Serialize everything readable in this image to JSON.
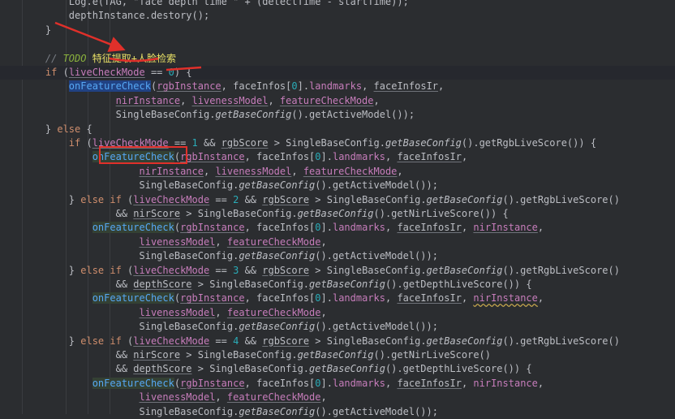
{
  "code_lines": [
    {
      "tokens": [
        {
          "t": "        Log.e(TAG, \"face depth time \" + (detectTime - startTime));",
          "c": "ident"
        }
      ]
    },
    {
      "tokens": [
        {
          "t": "        ",
          "c": "ident"
        },
        {
          "t": "depthInstance",
          "c": "ident"
        },
        {
          "t": ".destory();",
          "c": "ident"
        }
      ]
    },
    {
      "tokens": [
        {
          "t": "    }",
          "c": "ident"
        }
      ]
    },
    {
      "tokens": []
    },
    {
      "tokens": [
        {
          "t": "    // ",
          "c": "comment"
        },
        {
          "t": "TODO",
          "c": "todo"
        },
        {
          "t": " ",
          "c": "todo"
        },
        {
          "t": "特征提取+人脸检索",
          "c": "cn"
        }
      ]
    },
    {
      "tokens": [
        {
          "t": "    ",
          "c": "ident"
        },
        {
          "t": "if",
          "c": "kw"
        },
        {
          "t": " (",
          "c": "ident"
        },
        {
          "t": "liveCheckMode",
          "c": "field ul"
        },
        {
          "t": " == ",
          "c": "ident"
        },
        {
          "t": "0",
          "c": "num"
        },
        {
          "t": ") {",
          "c": "ident"
        }
      ],
      "current": true
    },
    {
      "tokens": [
        {
          "t": "        ",
          "c": "ident"
        },
        {
          "t": "onFeatureCheck",
          "c": "fn hl-strong"
        },
        {
          "t": "(",
          "c": "ident"
        },
        {
          "t": "rgbInstance",
          "c": "field ul"
        },
        {
          "t": ", faceInfos[",
          "c": "ident"
        },
        {
          "t": "0",
          "c": "num"
        },
        {
          "t": "].",
          "c": "ident"
        },
        {
          "t": "landmarks",
          "c": "field"
        },
        {
          "t": ", ",
          "c": "ident"
        },
        {
          "t": "faceInfosIr",
          "c": "ident ul"
        },
        {
          "t": ",",
          "c": "ident"
        }
      ]
    },
    {
      "tokens": [
        {
          "t": "                ",
          "c": "ident"
        },
        {
          "t": "nirInstance",
          "c": "field ul"
        },
        {
          "t": ", ",
          "c": "ident"
        },
        {
          "t": "livenessModel",
          "c": "field ul"
        },
        {
          "t": ", ",
          "c": "ident"
        },
        {
          "t": "featureCheckMode",
          "c": "field ul"
        },
        {
          "t": ",",
          "c": "ident"
        }
      ]
    },
    {
      "tokens": [
        {
          "t": "                SingleBaseConfig.",
          "c": "ident"
        },
        {
          "t": "getBaseConfig",
          "c": "static"
        },
        {
          "t": "().getActiveModel());",
          "c": "ident"
        }
      ]
    },
    {
      "tokens": [
        {
          "t": "    } ",
          "c": "ident"
        },
        {
          "t": "else",
          "c": "kw"
        },
        {
          "t": " {",
          "c": "ident"
        }
      ]
    },
    {
      "tokens": [
        {
          "t": "        ",
          "c": "ident"
        },
        {
          "t": "if",
          "c": "kw"
        },
        {
          "t": " (",
          "c": "ident"
        },
        {
          "t": "liveCheckMode",
          "c": "field ul"
        },
        {
          "t": " == ",
          "c": "ident"
        },
        {
          "t": "1",
          "c": "num"
        },
        {
          "t": " && ",
          "c": "ident"
        },
        {
          "t": "rgbScore",
          "c": "ident ul"
        },
        {
          "t": " > SingleBaseConfig.",
          "c": "ident"
        },
        {
          "t": "getBaseConfig",
          "c": "static"
        },
        {
          "t": "().getRgbLiveScore()) {",
          "c": "ident"
        }
      ]
    },
    {
      "tokens": [
        {
          "t": "            ",
          "c": "ident"
        },
        {
          "t": "onFeatureCheck",
          "c": "fn hl-soft"
        },
        {
          "t": "(",
          "c": "ident"
        },
        {
          "t": "rgbInstance",
          "c": "field ul"
        },
        {
          "t": ", faceInfos[",
          "c": "ident"
        },
        {
          "t": "0",
          "c": "num"
        },
        {
          "t": "].",
          "c": "ident"
        },
        {
          "t": "landmarks",
          "c": "field"
        },
        {
          "t": ", ",
          "c": "ident"
        },
        {
          "t": "faceInfosIr",
          "c": "ident ul"
        },
        {
          "t": ",",
          "c": "ident"
        }
      ]
    },
    {
      "tokens": [
        {
          "t": "                    ",
          "c": "ident"
        },
        {
          "t": "nirInstance",
          "c": "field ul"
        },
        {
          "t": ", ",
          "c": "ident"
        },
        {
          "t": "livenessModel",
          "c": "field ul"
        },
        {
          "t": ", ",
          "c": "ident"
        },
        {
          "t": "featureCheckMode",
          "c": "field ul"
        },
        {
          "t": ",",
          "c": "ident"
        }
      ]
    },
    {
      "tokens": [
        {
          "t": "                    SingleBaseConfig.",
          "c": "ident"
        },
        {
          "t": "getBaseConfig",
          "c": "static"
        },
        {
          "t": "().getActiveModel());",
          "c": "ident"
        }
      ]
    },
    {
      "tokens": [
        {
          "t": "        } ",
          "c": "ident"
        },
        {
          "t": "else if",
          "c": "kw"
        },
        {
          "t": " (",
          "c": "ident"
        },
        {
          "t": "liveCheckMode",
          "c": "field ul"
        },
        {
          "t": " == ",
          "c": "ident"
        },
        {
          "t": "2",
          "c": "num"
        },
        {
          "t": " && ",
          "c": "ident"
        },
        {
          "t": "rgbScore",
          "c": "ident ul"
        },
        {
          "t": " > SingleBaseConfig.",
          "c": "ident"
        },
        {
          "t": "getBaseConfig",
          "c": "static"
        },
        {
          "t": "().getRgbLiveScore()",
          "c": "ident"
        }
      ]
    },
    {
      "tokens": [
        {
          "t": "                && ",
          "c": "ident"
        },
        {
          "t": "nirScore",
          "c": "ident ul"
        },
        {
          "t": " > SingleBaseConfig.",
          "c": "ident"
        },
        {
          "t": "getBaseConfig",
          "c": "static"
        },
        {
          "t": "().getNirLiveScore()) {",
          "c": "ident"
        }
      ]
    },
    {
      "tokens": [
        {
          "t": "            ",
          "c": "ident"
        },
        {
          "t": "onFeatureCheck",
          "c": "fn hl-soft"
        },
        {
          "t": "(",
          "c": "ident"
        },
        {
          "t": "rgbInstance",
          "c": "field ul"
        },
        {
          "t": ", faceInfos[",
          "c": "ident"
        },
        {
          "t": "0",
          "c": "num"
        },
        {
          "t": "].",
          "c": "ident"
        },
        {
          "t": "landmarks",
          "c": "field"
        },
        {
          "t": ", ",
          "c": "ident"
        },
        {
          "t": "faceInfosIr",
          "c": "ident ul"
        },
        {
          "t": ", ",
          "c": "ident"
        },
        {
          "t": "nirInstance",
          "c": "field ul"
        },
        {
          "t": ",",
          "c": "ident"
        }
      ]
    },
    {
      "tokens": [
        {
          "t": "                    ",
          "c": "ident"
        },
        {
          "t": "livenessModel",
          "c": "field ul"
        },
        {
          "t": ", ",
          "c": "ident"
        },
        {
          "t": "featureCheckMode",
          "c": "field ul"
        },
        {
          "t": ",",
          "c": "ident"
        }
      ]
    },
    {
      "tokens": [
        {
          "t": "                    SingleBaseConfig.",
          "c": "ident"
        },
        {
          "t": "getBaseConfig",
          "c": "static"
        },
        {
          "t": "().getActiveModel());",
          "c": "ident"
        }
      ]
    },
    {
      "tokens": [
        {
          "t": "        } ",
          "c": "ident"
        },
        {
          "t": "else if",
          "c": "kw"
        },
        {
          "t": " (",
          "c": "ident"
        },
        {
          "t": "liveCheckMode",
          "c": "field ul"
        },
        {
          "t": " == ",
          "c": "ident"
        },
        {
          "t": "3",
          "c": "num"
        },
        {
          "t": " && ",
          "c": "ident"
        },
        {
          "t": "rgbScore",
          "c": "ident ul"
        },
        {
          "t": " > SingleBaseConfig.",
          "c": "ident"
        },
        {
          "t": "getBaseConfig",
          "c": "static"
        },
        {
          "t": "().getRgbLiveScore()",
          "c": "ident"
        }
      ]
    },
    {
      "tokens": [
        {
          "t": "                && ",
          "c": "ident"
        },
        {
          "t": "depthScore",
          "c": "ident ul"
        },
        {
          "t": " > SingleBaseConfig.",
          "c": "ident"
        },
        {
          "t": "getBaseConfig",
          "c": "static"
        },
        {
          "t": "().getDepthLiveScore()) {",
          "c": "ident"
        }
      ]
    },
    {
      "tokens": [
        {
          "t": "            ",
          "c": "ident"
        },
        {
          "t": "onFeatureCheck",
          "c": "fn hl-soft"
        },
        {
          "t": "(",
          "c": "ident"
        },
        {
          "t": "rgbInstance",
          "c": "field ul"
        },
        {
          "t": ", faceInfos[",
          "c": "ident"
        },
        {
          "t": "0",
          "c": "num"
        },
        {
          "t": "].",
          "c": "ident"
        },
        {
          "t": "landmarks",
          "c": "field"
        },
        {
          "t": ", ",
          "c": "ident"
        },
        {
          "t": "faceInfosIr",
          "c": "ident ul"
        },
        {
          "t": ", ",
          "c": "ident"
        },
        {
          "t": "nirInstance",
          "c": "field wavy"
        },
        {
          "t": ",",
          "c": "ident"
        }
      ]
    },
    {
      "tokens": [
        {
          "t": "                    ",
          "c": "ident"
        },
        {
          "t": "livenessModel",
          "c": "field ul"
        },
        {
          "t": ", ",
          "c": "ident"
        },
        {
          "t": "featureCheckMode",
          "c": "field ul"
        },
        {
          "t": ",",
          "c": "ident"
        }
      ]
    },
    {
      "tokens": [
        {
          "t": "                    SingleBaseConfig.",
          "c": "ident"
        },
        {
          "t": "getBaseConfig",
          "c": "static"
        },
        {
          "t": "().getActiveModel());",
          "c": "ident"
        }
      ]
    },
    {
      "tokens": [
        {
          "t": "        } ",
          "c": "ident"
        },
        {
          "t": "else if",
          "c": "kw"
        },
        {
          "t": " (",
          "c": "ident"
        },
        {
          "t": "liveCheckMode",
          "c": "field ul"
        },
        {
          "t": " == ",
          "c": "ident"
        },
        {
          "t": "4",
          "c": "num"
        },
        {
          "t": " && ",
          "c": "ident"
        },
        {
          "t": "rgbScore",
          "c": "ident ul"
        },
        {
          "t": " > SingleBaseConfig.",
          "c": "ident"
        },
        {
          "t": "getBaseConfig",
          "c": "static"
        },
        {
          "t": "().getRgbLiveScore()",
          "c": "ident"
        }
      ]
    },
    {
      "tokens": [
        {
          "t": "                && ",
          "c": "ident"
        },
        {
          "t": "nirScore",
          "c": "ident ul"
        },
        {
          "t": " > SingleBaseConfig.",
          "c": "ident"
        },
        {
          "t": "getBaseConfig",
          "c": "static"
        },
        {
          "t": "().getNirLiveScore()",
          "c": "ident"
        }
      ]
    },
    {
      "tokens": [
        {
          "t": "                && ",
          "c": "ident"
        },
        {
          "t": "depthScore",
          "c": "ident ul"
        },
        {
          "t": " > SingleBaseConfig.",
          "c": "ident"
        },
        {
          "t": "getBaseConfig",
          "c": "static"
        },
        {
          "t": "().getDepthLiveScore()) {",
          "c": "ident"
        }
      ]
    },
    {
      "tokens": [
        {
          "t": "            ",
          "c": "ident"
        },
        {
          "t": "onFeatureCheck",
          "c": "fn hl-soft"
        },
        {
          "t": "(",
          "c": "ident"
        },
        {
          "t": "rgbInstance",
          "c": "field ul"
        },
        {
          "t": ", faceInfos[",
          "c": "ident"
        },
        {
          "t": "0",
          "c": "num"
        },
        {
          "t": "].",
          "c": "ident"
        },
        {
          "t": "landmarks",
          "c": "field"
        },
        {
          "t": ", ",
          "c": "ident"
        },
        {
          "t": "faceInfosIr",
          "c": "ident ul"
        },
        {
          "t": ", ",
          "c": "ident"
        },
        {
          "t": "nirInstance",
          "c": "field"
        },
        {
          "t": ",",
          "c": "ident"
        }
      ]
    },
    {
      "tokens": [
        {
          "t": "                    ",
          "c": "ident"
        },
        {
          "t": "livenessModel",
          "c": "field ul"
        },
        {
          "t": ", ",
          "c": "ident"
        },
        {
          "t": "featureCheckMode",
          "c": "field ul"
        },
        {
          "t": ",",
          "c": "ident"
        }
      ]
    },
    {
      "tokens": [
        {
          "t": "                    SingleBaseConfig.",
          "c": "ident"
        },
        {
          "t": "getBaseConfig",
          "c": "static"
        },
        {
          "t": "().getActiveModel());",
          "c": "ident"
        }
      ]
    }
  ],
  "annotation_colors": {
    "arrow": "#e0302a",
    "box": "#e0302a"
  },
  "theme": {
    "background": "#2b2d30",
    "current_line": "#26282e"
  }
}
